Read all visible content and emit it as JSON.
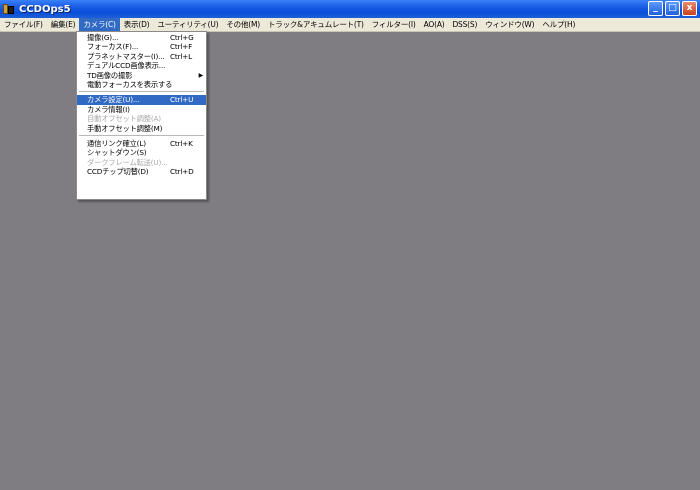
{
  "window": {
    "title": "CCDOps5"
  },
  "window_controls": {
    "minimize": "_",
    "maximize": "□",
    "close": "x"
  },
  "menubar": {
    "items": [
      "ファイル(F)",
      "編集(E)",
      "カメラ(C)",
      "表示(D)",
      "ユーティリティ(U)",
      "その他(M)",
      "トラック&アキュムレート(T)",
      "フィルター(I)",
      "AO(A)",
      "DSS(S)",
      "ウィンドウ(W)",
      "ヘルプ(H)"
    ],
    "active_index": 2
  },
  "camera_menu": {
    "items": [
      {
        "label": "撮像(G)...",
        "shortcut": "Ctrl+G"
      },
      {
        "label": "フォーカス(F)...",
        "shortcut": "Ctrl+F"
      },
      {
        "label": "プラネットマスター(I)...",
        "shortcut": "Ctrl+L"
      },
      {
        "label": "デュアルCCD画像表示...",
        "shortcut": ""
      },
      {
        "label": "TD画像の撮影",
        "shortcut": "",
        "submenu": "▶"
      },
      {
        "label": "電動フォーカスを表示する",
        "shortcut": ""
      },
      {
        "label": "カメラ設定(U)...",
        "shortcut": "Ctrl+U",
        "highlighted": true
      },
      {
        "label": "カメラ情報(I)",
        "shortcut": ""
      },
      {
        "label": "自動オフセット調整(A)",
        "shortcut": "",
        "disabled": true
      },
      {
        "label": "手動オフセット調整(M)",
        "shortcut": ""
      },
      {
        "label": "通信リンク確立(L)",
        "shortcut": "Ctrl+K"
      },
      {
        "label": "シャットダウン(S)",
        "shortcut": ""
      },
      {
        "label": "ダークフレーム転送(U)...",
        "shortcut": "",
        "disabled": true
      },
      {
        "label": "CCDチップ切替(D)",
        "shortcut": "Ctrl+D"
      }
    ]
  },
  "colors": {
    "workspace": "#807d82",
    "menubar": "#ece9d8",
    "highlight": "#316ac5",
    "titlebar": "#0a4fd8"
  }
}
